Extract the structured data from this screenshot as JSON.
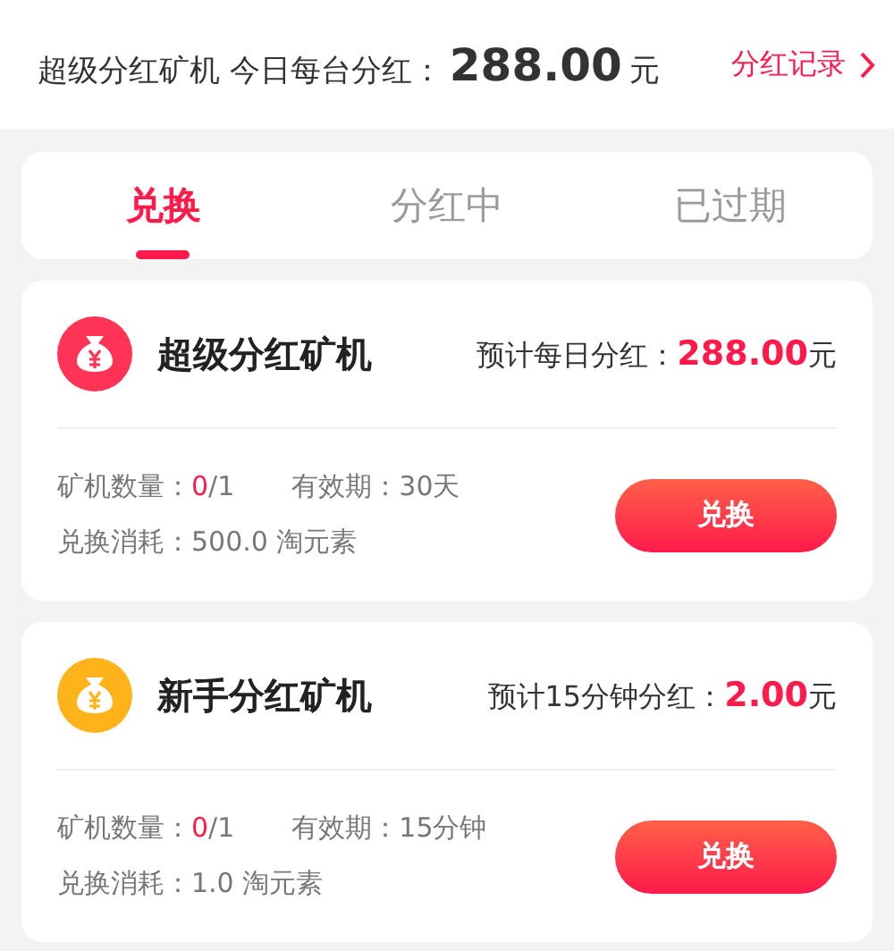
{
  "header": {
    "label": "超级分红矿机 今日每台分红：",
    "amount": "288.00",
    "unit": "元",
    "link": "分红记录"
  },
  "tabs": [
    {
      "label": "兑换",
      "selected": true
    },
    {
      "label": "分红中",
      "selected": false
    },
    {
      "label": "已过期",
      "selected": false
    }
  ],
  "machines": [
    {
      "name": "超级分红矿机",
      "color": "#ff3355",
      "dividend_label": "预计每日分红：",
      "dividend_amount": "288.00",
      "dividend_unit": "元",
      "quantity_label": "矿机数量：",
      "quantity_owned": "0",
      "quantity_total": "/1",
      "validity": "有效期：30天",
      "cost": "兑换消耗：500.0 淘元素",
      "button": "兑换"
    },
    {
      "name": "新手分红矿机",
      "color": "#ffb31a",
      "dividend_label": "预计15分钟分红：",
      "dividend_amount": "2.00",
      "dividend_unit": "元",
      "quantity_label": "矿机数量：",
      "quantity_owned": "0",
      "quantity_total": "/1",
      "validity": "有效期：15分钟",
      "cost": "兑换消耗：1.0 淘元素",
      "button": "兑换"
    }
  ]
}
